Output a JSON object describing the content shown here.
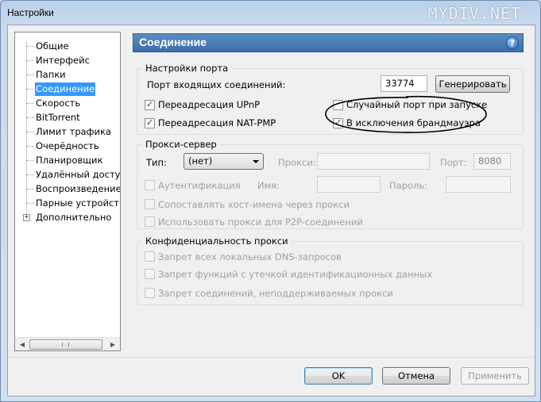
{
  "window": {
    "title": "Настройки",
    "watermark": "MYDIV.NET"
  },
  "sidebar": {
    "items": [
      {
        "label": "Общие"
      },
      {
        "label": "Интерфейс"
      },
      {
        "label": "Папки"
      },
      {
        "label": "Соединение",
        "selected": true
      },
      {
        "label": "Скорость"
      },
      {
        "label": "BitTorrent"
      },
      {
        "label": "Лимит трафика"
      },
      {
        "label": "Очерёдность"
      },
      {
        "label": "Планировщик"
      },
      {
        "label": "Удалённый доступ"
      },
      {
        "label": "Воспроизведение"
      },
      {
        "label": "Парные устройства"
      },
      {
        "label": "Дополнительно",
        "expander": "+"
      }
    ]
  },
  "panel": {
    "title": "Соединение",
    "help_icon": "?"
  },
  "port_settings": {
    "title": "Настройки порта",
    "incoming_port_label": "Порт входящих соединений:",
    "incoming_port_value": "33774",
    "generate_label": "Генерировать",
    "upnp_label": "Переадресация UPnP",
    "upnp_checked": true,
    "natpmp_label": "Переадресация NAT-PMP",
    "natpmp_checked": true,
    "random_port_label": "Случайный порт при запуске",
    "random_port_checked": false,
    "firewall_label": "В исключения брандмауэра",
    "firewall_checked": true
  },
  "proxy": {
    "title": "Прокси-сервер",
    "type_label": "Тип:",
    "type_value": "(нет)",
    "proxy_label": "Прокси:",
    "proxy_value": "",
    "port_label": "Порт:",
    "port_value": "8080",
    "auth_label": "Аутентификация",
    "name_label": "Имя:",
    "password_label": "Пароль:",
    "map_hostnames_label": "Сопоставлять хост-имена через прокси",
    "p2p_label": "Использовать прокси для P2P-соединений"
  },
  "privacy": {
    "title": "Конфиденциальность прокси",
    "dns_label": "Запрет всех локальных DNS-запросов",
    "leak_label": "Запрет функций с утечкой идентификационных данных",
    "unsupported_label": "Запрет соединений, неподдерживаемых прокси"
  },
  "buttons": {
    "ok": "OK",
    "cancel": "Отмена",
    "apply": "Применить"
  },
  "check_mark": "✓",
  "colors": {
    "header_bg": "#3b6ea8",
    "selection": "#3399ff"
  }
}
